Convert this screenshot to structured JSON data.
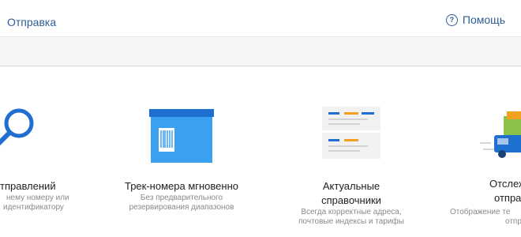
{
  "header": {
    "nav_label": "Отправка",
    "help_label": "Помощь",
    "help_icon": "question-circle-icon"
  },
  "features": [
    {
      "icon": "magnifier-icon",
      "title": "тправлений",
      "desc": [
        "нему номеру или",
        "идентификатору"
      ]
    },
    {
      "icon": "barcode-box-icon",
      "title": "Трек-номера мгновенно",
      "desc": [
        "Без предварительного",
        "резервирования диапазонов"
      ]
    },
    {
      "icon": "directory-list-icon",
      "title_lines": [
        "Актуальные",
        "справочники"
      ],
      "desc": [
        "Всегда корректные адреса,",
        "почтовые индексы и тарифы"
      ]
    },
    {
      "icon": "delivery-truck-icon",
      "title_lines": [
        "Отслеж",
        "отправ"
      ],
      "desc": [
        "Отображение те",
        "отпра"
      ]
    }
  ],
  "colors": {
    "link": "#2a5d96",
    "accent_blue": "#1f6fd1",
    "box_light_blue": "#3aa0f0",
    "accent_orange": "#f3a020"
  }
}
